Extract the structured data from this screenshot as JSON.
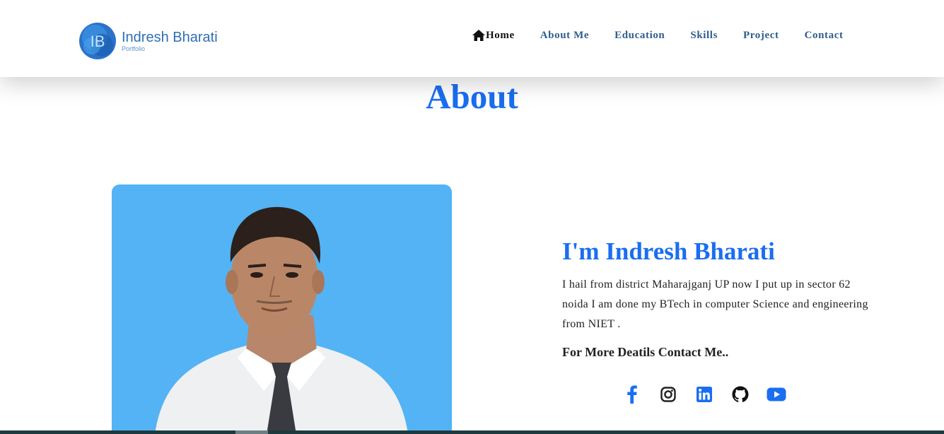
{
  "brand": {
    "logo_letter": "IB",
    "name": "Indresh Bharati",
    "subtitle": "Portfolio"
  },
  "nav": {
    "items": [
      {
        "label": "Home",
        "icon": "home-icon",
        "active": true
      },
      {
        "label": "About Me"
      },
      {
        "label": "Education"
      },
      {
        "label": "Skills"
      },
      {
        "label": "Project"
      },
      {
        "label": "Contact"
      }
    ]
  },
  "about": {
    "title": "About",
    "heading": "I'm Indresh Bharati",
    "description": "I hail from district Maharajganj UP now I put up in sector 62 noida I am done my BTech in computer Science and engineering from NIET .",
    "contact_line": "For More Deatils Contact Me.."
  },
  "socials": [
    {
      "name": "facebook-icon",
      "color": "#1a6ef0"
    },
    {
      "name": "instagram-icon",
      "color": "#222222"
    },
    {
      "name": "linkedin-icon",
      "color": "#1a6ef0"
    },
    {
      "name": "github-icon",
      "color": "#111111"
    },
    {
      "name": "youtube-icon",
      "color": "#1a6ef0"
    }
  ],
  "colors": {
    "accent": "#1a6ef0",
    "nav_text": "#2f5d8c",
    "photo_bg": "#53b3f5"
  }
}
